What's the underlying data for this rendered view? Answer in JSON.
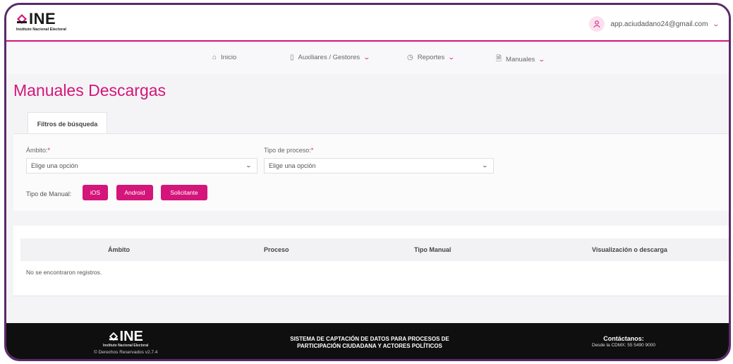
{
  "header": {
    "logo_text": "INE",
    "logo_subtitle": "Instituto Nacional Electoral",
    "user_email": "app.aciudadano24@gmail.com"
  },
  "nav": {
    "items": [
      {
        "label": "Inicio",
        "icon": "home-icon"
      },
      {
        "label": "Auxiliares / Gestores",
        "icon": "clipboard-icon",
        "dropdown": true
      },
      {
        "label": "Reportes",
        "icon": "clock-icon",
        "dropdown": true
      },
      {
        "label": "Manuales",
        "icon": "document-icon",
        "dropdown": true
      }
    ]
  },
  "page": {
    "title": "Manuales Descargas"
  },
  "filters": {
    "tab_label": "Filtros de búsqueda",
    "ambito_label": "Ámbito:",
    "ambito_value": "Elige una opción",
    "proceso_label": "Tipo de proceso:",
    "proceso_value": "Elige una opción",
    "required_mark": "*",
    "tipo_manual_label": "Tipo de Manual:",
    "buttons": [
      "iOS",
      "Android",
      "Solicitante"
    ]
  },
  "table": {
    "columns": [
      "Ámbito",
      "Proceso",
      "Tipo Manual",
      "Visualización o descarga"
    ],
    "empty_message": "No se encontraron registros."
  },
  "footer": {
    "logo_text": "INE",
    "logo_subtitle": "Instituto Nacional Electoral",
    "rights": "© Derechos Reservados v2.7.4",
    "system_line1": "SISTEMA DE CAPTACIÓN DE DATOS PARA PROCESOS DE",
    "system_line2": "PARTICIPACIÓN CIUDADANA Y ACTORES POLÍTICOS",
    "contact_title": "Contáctanos:",
    "contact_phone": "Desde la CDMX: 55 5490 9000"
  },
  "colors": {
    "accent": "#d4157a",
    "frame": "#5a2a6b",
    "footer_bg": "#0f0f10"
  }
}
